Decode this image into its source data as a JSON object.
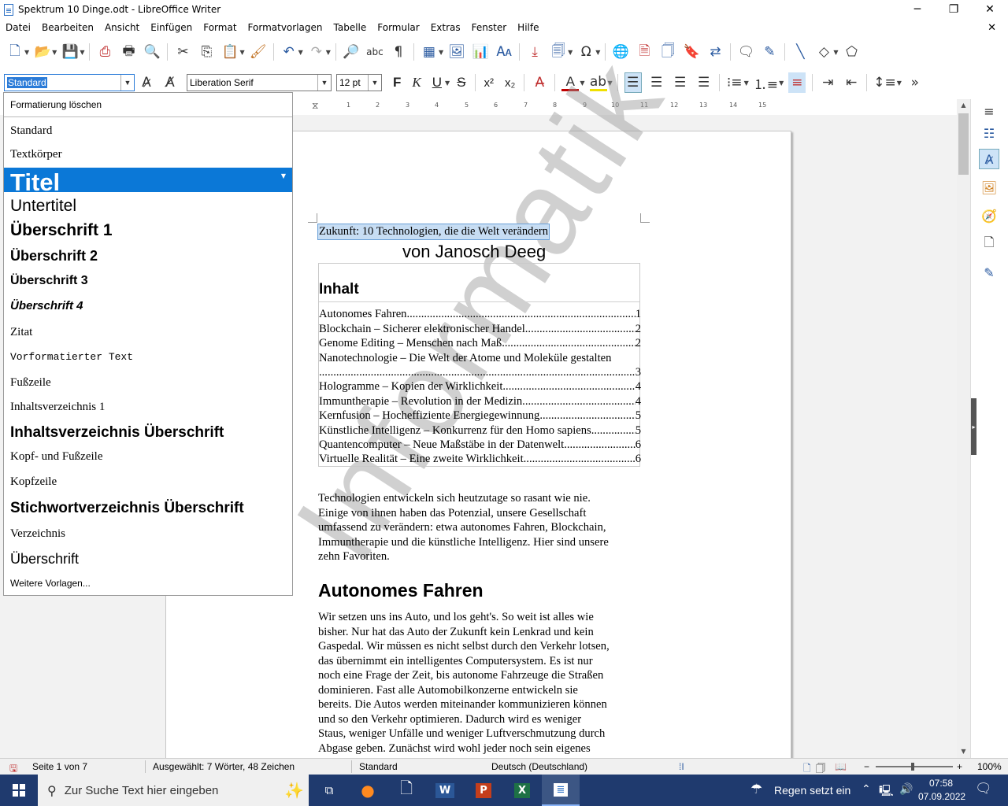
{
  "window": {
    "title": "Spektrum 10 Dinge.odt - LibreOffice Writer",
    "minimize": "─",
    "maximize": "❐",
    "close": "✕"
  },
  "menubar": {
    "items": [
      "Datei",
      "Bearbeiten",
      "Ansicht",
      "Einfügen",
      "Format",
      "Formatvorlagen",
      "Tabelle",
      "Formular",
      "Extras",
      "Fenster",
      "Hilfe"
    ],
    "close_doc": "✕"
  },
  "formatting_toolbar": {
    "paragraph_style": "Standard",
    "font_name": "Liberation Serif",
    "font_size": "12 pt",
    "bold": "F",
    "italic": "K",
    "underline": "U",
    "strikethrough": "S",
    "superscript": "x²",
    "subscript": "x₂"
  },
  "style_dropdown": {
    "clear": "Formatierung löschen",
    "items": [
      "Standard",
      "Textkörper",
      "Titel",
      "Untertitel",
      "Überschrift 1",
      "Überschrift 2",
      "Überschrift 3",
      "Überschrift 4",
      "Zitat",
      "Vorformatierter Text",
      "Fußzeile",
      "Inhaltsverzeichnis 1",
      "Inhaltsverzeichnis Überschrift",
      "Kopf- und Fußzeile",
      "Kopfzeile",
      "Stichwortverzeichnis Überschrift",
      "Verzeichnis",
      "Überschrift"
    ],
    "selected": "Titel",
    "more": "Weitere Vorlagen..."
  },
  "ruler": {
    "ticks": [
      "1",
      "2",
      "3",
      "4",
      "5",
      "6",
      "7",
      "8",
      "9",
      "10",
      "11",
      "12",
      "13",
      "14",
      "15"
    ]
  },
  "document": {
    "title": "Zukunft: 10 Technologien, die die Welt verändern",
    "author": "von Janosch Deeg",
    "toc_heading": "Inhalt",
    "toc": [
      {
        "title": "Autonomes Fahren",
        "page": "1"
      },
      {
        "title": "Blockchain – Sicherer elektronischer Handel",
        "page": "2"
      },
      {
        "title": "Genome Editing – Menschen nach Maß",
        "page": "2"
      },
      {
        "title": "Nanotechnologie – Die Welt der Atome und Moleküle gestalten",
        "page": ""
      },
      {
        "title": "",
        "page": "3"
      },
      {
        "title": "Hologramme – Kopien der Wirklichkeit",
        "page": "4"
      },
      {
        "title": "Immuntherapie – Revolution in der Medizin",
        "page": "4"
      },
      {
        "title": "Kernfusion – Hocheffiziente Energiegewinnung",
        "page": "5"
      },
      {
        "title": "Künstliche Intelligenz – Konkurrenz für den Homo sapiens",
        "page": "5"
      },
      {
        "title": "Quantencomputer – Neue Maßstäbe in der Datenwelt",
        "page": "6"
      },
      {
        "title": "Virtuelle Realität – Eine zweite Wirklichkeit",
        "page": "6"
      }
    ],
    "intro_lines": [
      "Technologien entwickeln sich heutzutage so rasant wie nie.",
      "Einige von ihnen haben das Potenzial, unsere Gesellschaft",
      "umfassend zu verändern: etwa autonomes Fahren, Blockchain,",
      "Immuntherapie und die künstliche Intelligenz. Hier sind unsere",
      "zehn Favoriten."
    ],
    "section_heading": "Autonomes Fahren",
    "section_lines": [
      "Wir setzen uns ins Auto, und los geht's. So weit ist alles wie",
      "bisher. Nur hat das Auto der Zukunft kein Lenkrad und kein",
      "Gaspedal. Wir müssen es nicht selbst durch den Verkehr lotsen,",
      "das übernimmt ein intelligentes Computersystem. Es ist nur",
      "noch eine Frage der Zeit, bis autonome Fahrzeuge die Straßen",
      "dominieren. Fast alle Automobilkonzerne entwickeln sie",
      "bereits. Die Autos werden miteinander kommunizieren können",
      "und so den Verkehr optimieren. Dadurch wird es weniger",
      "Staus, weniger Unfälle und weniger Luftverschmutzung durch",
      "Abgase geben. Zunächst wird wohl jeder noch sein eigenes"
    ],
    "watermark": "Informatik"
  },
  "statusbar": {
    "page": "Seite 1 von 7",
    "selection": "Ausgewählt: 7 Wörter, 48 Zeichen",
    "style": "Standard",
    "language": "Deutsch (Deutschland)",
    "zoom": "100%"
  },
  "taskbar": {
    "search_placeholder": "Zur Suche Text hier eingeben",
    "weather": "Regen setzt ein",
    "time": "07:58",
    "date": "07.09.2022"
  },
  "colors": {
    "accent": "#0b78d7",
    "taskbar": "#1f3a6e",
    "selection_highlight": "#c7ddf3"
  }
}
